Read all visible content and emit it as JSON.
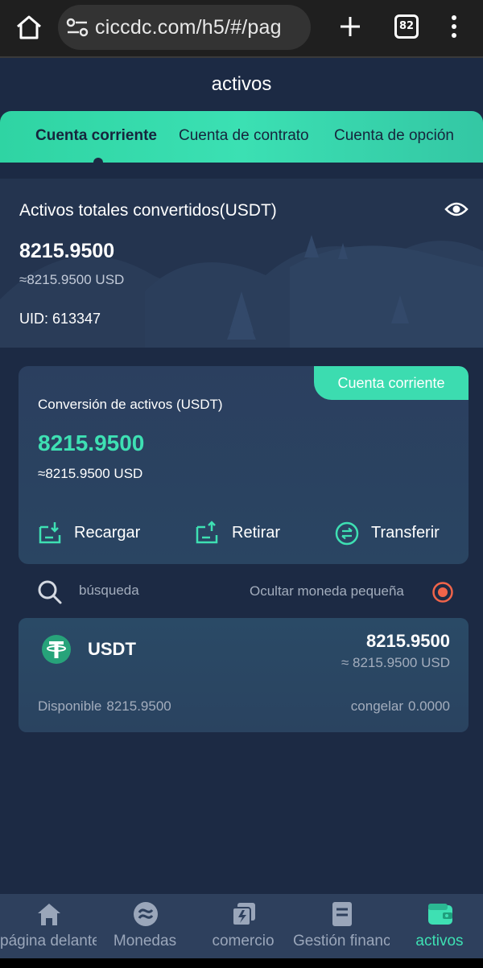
{
  "browser": {
    "url": "ciccdc.com/h5/#/pag",
    "tab_count": "82",
    "icons": [
      "home-icon",
      "site-settings-icon",
      "new-tab-plus-icon",
      "tab-switcher-icon",
      "more-menu-icon"
    ]
  },
  "header": {
    "title": "activos"
  },
  "tabs": [
    {
      "label": "Cuenta corriente",
      "active": true
    },
    {
      "label": "Cuenta de contrato",
      "active": false
    },
    {
      "label": "Cuenta de opción",
      "active": false
    }
  ],
  "total": {
    "title": "Activos totales convertidos(USDT)",
    "value": "8215.9500",
    "usd": "≈8215.9500 USD",
    "uid": "UID: 613347"
  },
  "conversion": {
    "tag": "Cuenta corriente",
    "title": "Conversión de activos (USDT)",
    "value": "8215.9500",
    "usd": "≈8215.9500 USD",
    "actions": [
      {
        "label": "Recargar",
        "icon": "deposit-icon"
      },
      {
        "label": "Retirar",
        "icon": "withdraw-icon"
      },
      {
        "label": "Transferir",
        "icon": "transfer-icon"
      }
    ]
  },
  "search": {
    "placeholder": "búsqueda",
    "hide_small_label": "Ocultar moneda pequeña"
  },
  "coins": [
    {
      "name": "USDT",
      "value": "8215.9500",
      "usd": "≈ 8215.9500 USD",
      "available_label": "Disponible",
      "available_value": "8215.9500",
      "frozen_label": "congelar",
      "frozen_value": "0.0000"
    }
  ],
  "nav": [
    {
      "label": "página delante",
      "icon": "home-icon",
      "active": false
    },
    {
      "label": "Monedas",
      "icon": "coins-exchange-icon",
      "active": false
    },
    {
      "label": "comercio",
      "icon": "trade-icon",
      "active": false
    },
    {
      "label": "Gestión financiera",
      "icon": "document-icon",
      "active": false
    },
    {
      "label": "activos",
      "icon": "wallet-icon",
      "active": true
    }
  ],
  "colors": {
    "accent": "#3ee0b3",
    "background": "#1c2a44",
    "card": "#2b3f5f",
    "radio": "#f0644a"
  }
}
